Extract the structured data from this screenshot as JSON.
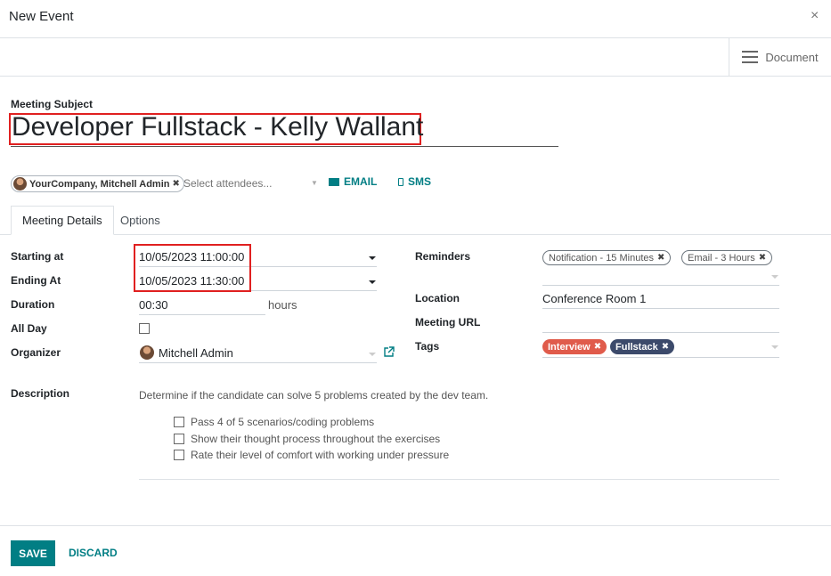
{
  "dialog": {
    "title": "New Event",
    "close_symbol": "×"
  },
  "statusbar": {
    "document_label": "Document"
  },
  "subject": {
    "label": "Meeting Subject",
    "value": "Developer Fullstack - Kelly Wallant"
  },
  "attendees": {
    "chips": [
      {
        "label": "YourCompany, Mitchell Admin"
      }
    ],
    "placeholder": "Select attendees...",
    "email_label": "EMAIL",
    "sms_label": "SMS"
  },
  "tabs": [
    {
      "label": "Meeting Details",
      "active": true
    },
    {
      "label": "Options",
      "active": false
    }
  ],
  "left_fields": {
    "starting_at": {
      "label": "Starting at",
      "value": "10/05/2023 11:00:00"
    },
    "ending_at": {
      "label": "Ending At",
      "value": "10/05/2023 11:30:00"
    },
    "duration": {
      "label": "Duration",
      "value": "00:30",
      "unit": "hours"
    },
    "all_day": {
      "label": "All Day",
      "checked": false
    },
    "organizer": {
      "label": "Organizer",
      "value": "Mitchell Admin"
    }
  },
  "right_fields": {
    "reminders": {
      "label": "Reminders",
      "tags": [
        "Notification - 15 Minutes",
        "Email - 3 Hours"
      ]
    },
    "location": {
      "label": "Location",
      "value": "Conference Room 1"
    },
    "meeting_url": {
      "label": "Meeting URL",
      "value": ""
    },
    "tags": {
      "label": "Tags",
      "items": [
        {
          "label": "Interview",
          "color": "#e05b4b"
        },
        {
          "label": "Fullstack",
          "color": "#3c4a6b"
        }
      ]
    }
  },
  "description": {
    "label": "Description",
    "text": "Determine if the candidate can solve 5 problems created by the dev team.",
    "tasks": [
      "Pass 4 of 5 scenarios/coding problems",
      "Show their thought process throughout the exercises",
      "Rate their level of comfort with working under pressure"
    ]
  },
  "footer": {
    "save_label": "SAVE",
    "discard_label": "DISCARD"
  },
  "colors": {
    "accent": "#017e84",
    "highlight_box": "#e02020"
  },
  "icons": {
    "remove": "✖"
  }
}
